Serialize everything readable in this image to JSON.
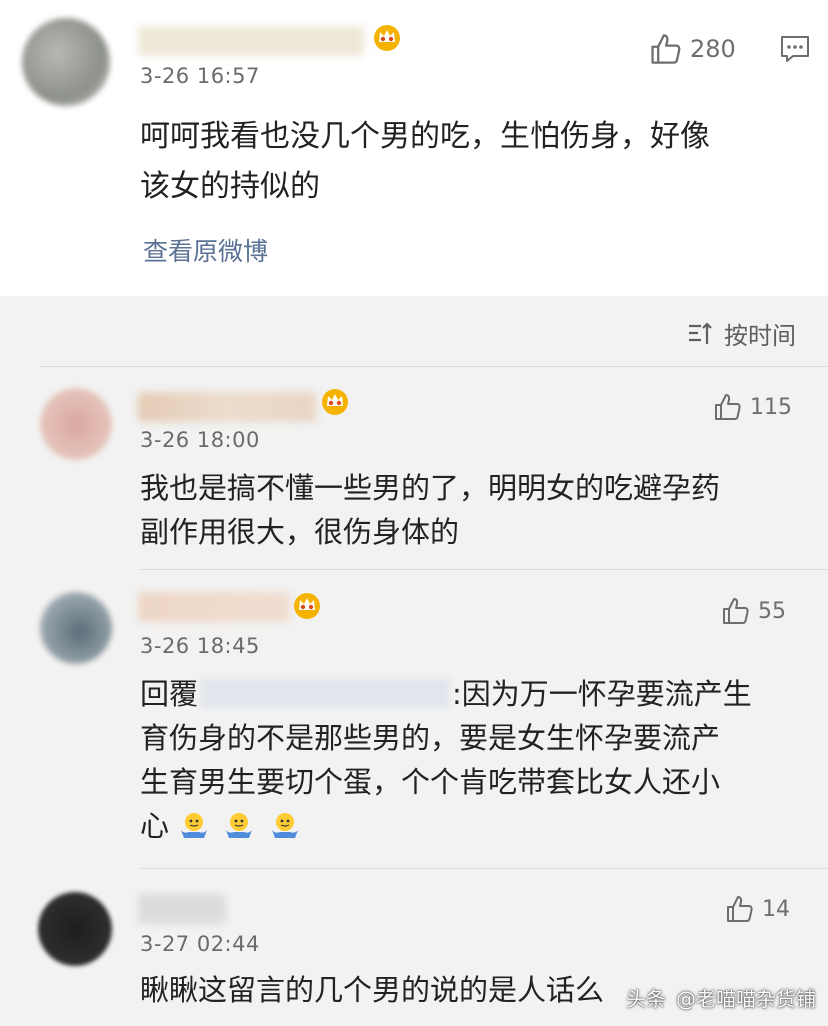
{
  "post": {
    "time": "3-26 16:57",
    "likes": "280",
    "content_lines": [
      "呵呵我看也没几个男的吃，生怕伤身，好像",
      "该女的持似的"
    ],
    "view_original": "查看原微博"
  },
  "sort": {
    "label": "按时间"
  },
  "comments": [
    {
      "time": "3-26 18:00",
      "likes": "115",
      "lines": [
        "我也是搞不懂一些男的了，明明女的吃避孕药",
        "副作用很大，很伤身体的"
      ]
    },
    {
      "time": "3-26 18:45",
      "likes": "55",
      "reply_prefix": "回覆",
      "first_line_rest": ":因为万一怀孕要流产生",
      "lines": [
        "育伤身的不是那些男的，要是女生怀孕要流产",
        "生育男生要切个蛋，个个肯吃带套比女人还小"
      ],
      "last_line": "心"
    },
    {
      "time": "3-27 02:44",
      "likes": "14",
      "lines": [
        "瞅瞅这留言的几个男的说的是人话么"
      ]
    }
  ],
  "watermark": {
    "prefix": "头条",
    "account": "@老喵喵杂货铺"
  },
  "icons": {
    "like": "thumbs-up-icon",
    "comment": "comment-bubble-icon",
    "sort": "sort-icon",
    "badge": "crown-badge-icon",
    "emoji": "shrug-emoji-icon"
  },
  "colors": {
    "link": "#5b7295",
    "badge": "#f5b300",
    "reply_bg": "#f2f2f2"
  }
}
